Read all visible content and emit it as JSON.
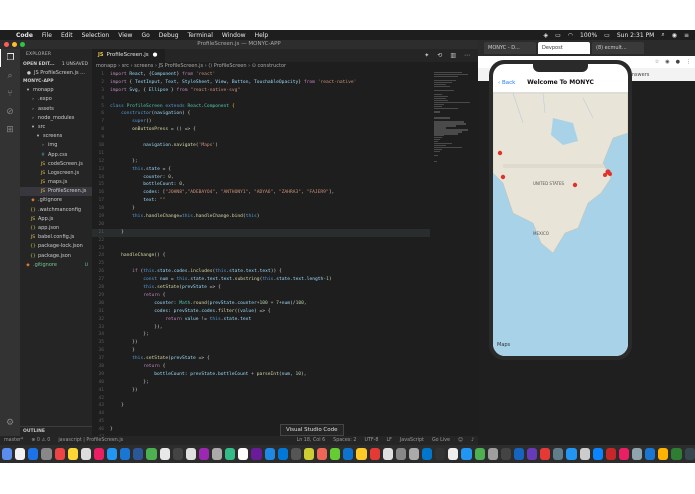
{
  "menubar": {
    "app": "Code",
    "items": [
      "File",
      "Edit",
      "Selection",
      "View",
      "Go",
      "Debug",
      "Terminal",
      "Window",
      "Help"
    ],
    "battery": "100%",
    "clock": "Sun 2:31 PM"
  },
  "vscode": {
    "window_title": "ProfileScreen.js — MONYC-APP",
    "sidebar": {
      "explorer_label": "EXPLORER",
      "open_editors_label": "OPEN EDIT...",
      "unsaved_label": "1 UNSAVED",
      "open_file": "JS ProfileScreen.js ...",
      "project_label": "MONYC-APP",
      "tree": [
        {
          "label": "monapp",
          "icon": "▾",
          "depth": 1
        },
        {
          "label": ".expo",
          "icon": "›",
          "depth": 2
        },
        {
          "label": "assets",
          "icon": "›",
          "depth": 2
        },
        {
          "label": "node_modules",
          "icon": "›",
          "depth": 2
        },
        {
          "label": "src",
          "icon": "▾",
          "depth": 2
        },
        {
          "label": "screens",
          "icon": "▾",
          "depth": 3
        },
        {
          "label": "img",
          "icon": "›",
          "depth": 4
        },
        {
          "label": "App.css",
          "icon": "#",
          "depth": 4
        },
        {
          "label": "codeScreen.js",
          "icon": "JS",
          "depth": 4
        },
        {
          "label": "Logscreen.js",
          "icon": "JS",
          "depth": 4
        },
        {
          "label": "maps.js",
          "icon": "JS",
          "depth": 4
        },
        {
          "label": "ProfileScreen.js",
          "icon": "JS",
          "depth": 4,
          "selected": true
        },
        {
          "label": ".gitignore",
          "icon": "◆",
          "depth": 2
        },
        {
          "label": ".watchmanconfig",
          "icon": "{}",
          "depth": 2
        },
        {
          "label": "App.js",
          "icon": "JS",
          "depth": 2
        },
        {
          "label": "app.json",
          "icon": "{}",
          "depth": 2
        },
        {
          "label": "babel.config.js",
          "icon": "JS",
          "depth": 2
        },
        {
          "label": "package-lock.json",
          "icon": "{}",
          "depth": 2
        },
        {
          "label": "package.json",
          "icon": "{}",
          "depth": 2
        },
        {
          "label": ".gitignore",
          "icon": "◆",
          "depth": 1,
          "badge": "U"
        }
      ],
      "outline_label": "OUTLINE"
    },
    "tab": {
      "label": "ProfileScreen.js",
      "dirty": "●"
    },
    "breadcrumb": "monapp › src › screens › JS ProfileScreen.js › ⟨⟩ ProfileScreen › ⊙ constructor",
    "tooltip": "Visual Studio Code",
    "statusbar": {
      "branch": "master*",
      "sync": "⊗ 0 ⚠ 0",
      "lang_info": "javascript | ProfileScreen.js",
      "position": "Ln 18, Col 6",
      "spaces": "Spaces: 2",
      "encoding": "UTF-8",
      "eol": "LF",
      "language": "JavaScript",
      "golive": "Go Live"
    }
  },
  "browser": {
    "tabs": [
      "MONYC - D...",
      "Devpost",
      "(8) ecmult..."
    ],
    "bookmark": "orithms answers",
    "phone": {
      "back_label": "Back",
      "title": "Welcome To MONYC",
      "map_country": "UNITED STATES",
      "map_country2": "MEXICO",
      "map_label": "Maps"
    }
  },
  "colors": {
    "editor_bg": "#1e1e1e",
    "sidebar_bg": "#252526",
    "accent": "#1e7cf7",
    "map_water": "#a8d2e8",
    "map_land": "#e8e4d8",
    "pin": "#e0322b"
  }
}
